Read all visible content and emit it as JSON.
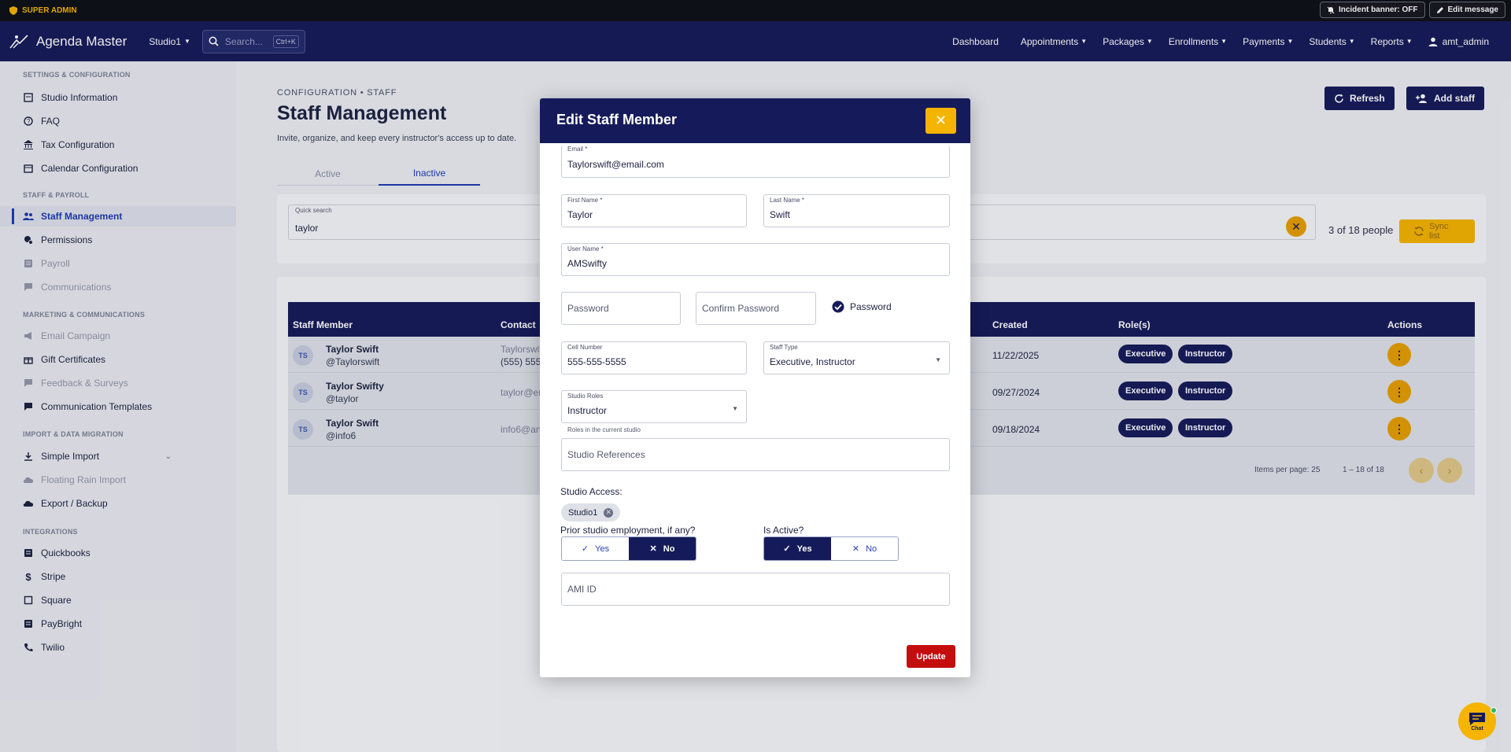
{
  "topbar": {
    "role_label": "SUPER ADMIN",
    "incident_label": "Incident banner: OFF",
    "edit_message_label": "Edit message"
  },
  "navbar": {
    "app_name": "Agenda Master",
    "studio": "Studio1",
    "search_placeholder": "Search...",
    "search_shortcut": "Ctrl+K",
    "links": [
      "Dashboard",
      "Appointments",
      "Packages",
      "Enrollments",
      "Payments",
      "Students",
      "Reports"
    ],
    "user": "amt_admin"
  },
  "sidebar": {
    "sections": [
      {
        "title": "SETTINGS & CONFIGURATION",
        "items": [
          {
            "label": "Studio Information",
            "icon": "studio-icon"
          },
          {
            "label": "FAQ",
            "icon": "help-icon"
          },
          {
            "label": "Tax Configuration",
            "icon": "bank-icon"
          },
          {
            "label": "Calendar Configuration",
            "icon": "calendar-icon"
          }
        ]
      },
      {
        "title": "STAFF & PAYROLL",
        "items": [
          {
            "label": "Staff Management",
            "icon": "people-icon",
            "active": true
          },
          {
            "label": "Permissions",
            "icon": "permissions-icon"
          },
          {
            "label": "Payroll",
            "icon": "payroll-icon",
            "dim": true
          },
          {
            "label": "Communications",
            "icon": "chat-icon",
            "dim": true
          }
        ]
      },
      {
        "title": "MARKETING & COMMUNICATIONS",
        "items": [
          {
            "label": "Email Campaign",
            "icon": "campaign-icon",
            "dim": true
          },
          {
            "label": "Gift Certificates",
            "icon": "gift-icon"
          },
          {
            "label": "Feedback & Surveys",
            "icon": "feedback-icon",
            "dim": true
          },
          {
            "label": "Communication Templates",
            "icon": "template-icon"
          }
        ]
      },
      {
        "title": "IMPORT & DATA MIGRATION",
        "items": [
          {
            "label": "Simple Import",
            "icon": "upload-icon"
          },
          {
            "label": "Floating Rain Import",
            "icon": "cloud-icon",
            "dim": true
          },
          {
            "label": "Export / Backup",
            "icon": "cloud-download-icon"
          }
        ]
      },
      {
        "title": "INTEGRATIONS",
        "items": [
          {
            "label": "Quickbooks",
            "icon": "quickbooks-icon"
          },
          {
            "label": "Stripe",
            "icon": "stripe-icon"
          },
          {
            "label": "Square",
            "icon": "square-icon"
          },
          {
            "label": "PayBright",
            "icon": "paybright-icon"
          },
          {
            "label": "Twilio",
            "icon": "phone-icon"
          }
        ]
      }
    ]
  },
  "page": {
    "breadcrumb": "CONFIGURATION • STAFF",
    "title": "Staff Management",
    "subtitle": "Invite, organize, and keep every instructor's access up to date.",
    "refresh_label": "Refresh",
    "add_staff_label": "Add staff",
    "tabs": [
      {
        "label": "Active"
      },
      {
        "label": "Inactive",
        "active": true
      }
    ],
    "quick_search_label": "Quick search",
    "quick_search_value": "taylor",
    "people_count": "3 of 18 people",
    "sync_label": "Sync list"
  },
  "table": {
    "headers": [
      "Staff Member",
      "Contact",
      "Created",
      "Role(s)",
      "Actions"
    ],
    "rows": [
      {
        "initials": "TS",
        "name": "Taylor Swift",
        "handle": "@Taylorswift",
        "contact_line1": "Taylorswift",
        "contact_line2": "(555) 555",
        "created": "11/22/2025",
        "roles": [
          "Executive",
          "Instructor"
        ]
      },
      {
        "initials": "TS",
        "name": "Taylor Swifty",
        "handle": "@taylor",
        "contact_line1": "taylor@en",
        "contact_line2": "",
        "created": "09/27/2024",
        "roles": [
          "Executive",
          "Instructor"
        ]
      },
      {
        "initials": "TS",
        "name": "Taylor Swift",
        "handle": "@info6",
        "contact_line1": "info6@art",
        "contact_line2": "",
        "created": "09/18/2024",
        "roles": [
          "Executive",
          "Instructor"
        ]
      }
    ],
    "items_per_page": "Items per page: 25",
    "range": "1 – 18 of 18"
  },
  "modal": {
    "title": "Edit Staff Member",
    "email_label": "Email *",
    "email_value": "Taylorswift@email.com",
    "first_name_label": "First Name *",
    "first_name_value": "Taylor",
    "last_name_label": "Last Name *",
    "last_name_value": "Swift",
    "username_label": "User Name *",
    "username_value": "AMSwifty",
    "password_placeholder": "Password",
    "confirm_password_placeholder": "Confirm Password",
    "password_check_label": "Password",
    "cell_label": "Cell Number",
    "cell_value": "555-555-5555",
    "staff_type_label": "Staff Type",
    "staff_type_value": "Executive, Instructor",
    "studio_roles_label": "Studio Roles",
    "studio_roles_value": "Instructor",
    "studio_roles_hint": "Roles in the current studio",
    "studio_references_placeholder": "Studio References",
    "studio_access_label": "Studio Access:",
    "studio_access_chip": "Studio1",
    "prior_employment_label": "Prior studio employment, if any?",
    "prior_yes": "Yes",
    "prior_no": "No",
    "prior_selected": "No",
    "is_active_label": "Is Active?",
    "active_yes": "Yes",
    "active_no": "No",
    "active_selected": "Yes",
    "ami_id_placeholder": "AMI ID",
    "update_label": "Update"
  },
  "chat": {
    "label": "Chat"
  },
  "colors": {
    "navy": "#151b5a",
    "accent": "#f5b400",
    "active_link": "#1d3bb3",
    "danger": "#c40d0d"
  }
}
